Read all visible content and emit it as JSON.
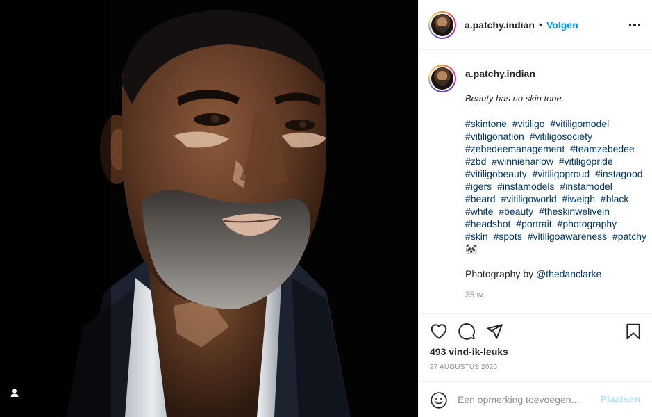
{
  "post": {
    "username": "a.patchy.indian",
    "follow_label": "Volgen",
    "header_separator": "•",
    "caption_intro": "Beauty has no skin tone.",
    "hashtags": [
      "#skintone",
      "#vitiligo",
      "#vitiligomodel",
      "#vitiligonation",
      "#vitiligosociety",
      "#zebedeemanagement",
      "#teamzebedee",
      "#zbd",
      "#winnieharlow",
      "#vitiligopride",
      "#vitiligobeauty",
      "#vitiligoproud",
      "#instagood",
      "#igers",
      "#instamodels",
      "#instamodel",
      "#beard",
      "#vitiligoworld",
      "#iweigh",
      "#black",
      "#white",
      "#beauty",
      "#theskinwelivein",
      "#headshot",
      "#portrait",
      "#photography",
      "#skin",
      "#spots",
      "#vitiligoawareness",
      "#patchy🐼"
    ],
    "credit_prefix": "Photography by ",
    "credit_mention": "@thedanclarke",
    "time_ago": "35 w.",
    "likes": "493 vind-ik-leuks",
    "date": "27 AUGUSTUS 2020"
  },
  "comment": {
    "placeholder": "Een opmerking toevoegen...",
    "post_label": "Plaatsen"
  },
  "icons": {
    "like": "heart-icon",
    "comment": "comment-bubble-icon",
    "share": "paper-plane-icon",
    "save": "bookmark-icon",
    "more": "more-options-icon",
    "emoji": "emoji-smiley-icon",
    "tag": "user-tag-icon"
  },
  "colors": {
    "link_blue": "#0095f6",
    "hashtag_navy": "#00376b",
    "disabled_post": "#b2dffc",
    "muted_text": "#8e8e8e"
  }
}
